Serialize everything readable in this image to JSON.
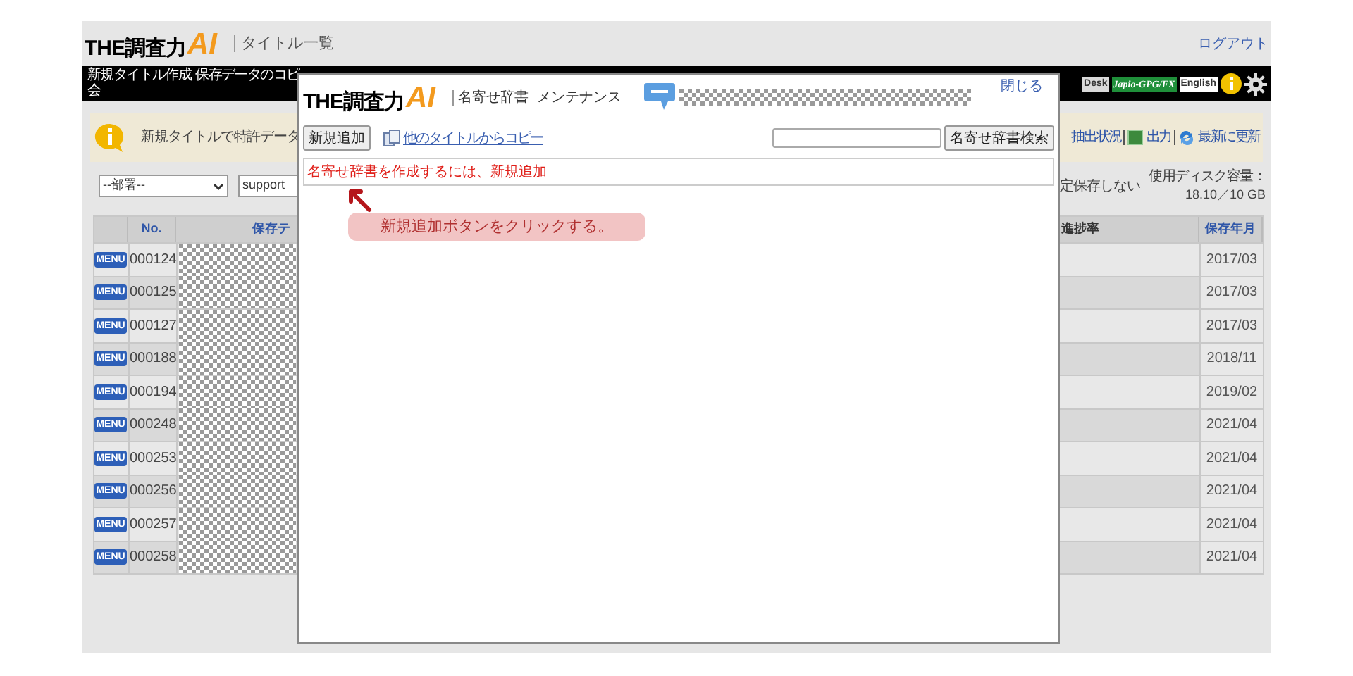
{
  "app_header": {
    "logo": {
      "main": "THE調査力",
      "accent": "AI"
    },
    "page_title": "タイトル一覧",
    "logout_link": "ログアウト"
  },
  "nav_bar": {
    "lines": [
      "新規タイトル作成",
      "保存データのコピ",
      "会"
    ],
    "badges": [
      {
        "label": "Desk",
        "color": "#d9d9d9"
      },
      {
        "label": "Japio-GPG/FX",
        "color": "#1f8f3a"
      },
      {
        "label": "English",
        "color": "#ffffff"
      }
    ]
  },
  "info_banner": {
    "message": "新規タイトルで特許データ",
    "actions": [
      {
        "kind": "text",
        "label": "抽出状況"
      },
      {
        "kind": "export",
        "label": "出力"
      },
      {
        "kind": "refresh",
        "label": "最新に更新"
      }
    ]
  },
  "filters": {
    "department_select": "--部署--",
    "user_field": "support",
    "save_option": "定保存しない",
    "disk_usage_label": "使用ディスク容量：",
    "disk_usage_value": "18.10／10 GB"
  },
  "table": {
    "columns": [
      "No.",
      "保存テ",
      "進捗率",
      "保存年月"
    ],
    "rows": [
      {
        "menu": "MENU",
        "no": "000124",
        "saved": "2017/03"
      },
      {
        "menu": "MENU",
        "no": "000125",
        "saved": "2017/03"
      },
      {
        "menu": "MENU",
        "no": "000127",
        "saved": "2017/03"
      },
      {
        "menu": "MENU",
        "no": "000188",
        "saved": "2018/11"
      },
      {
        "menu": "MENU",
        "no": "000194",
        "saved": "2019/02"
      },
      {
        "menu": "MENU",
        "no": "000248",
        "saved": "2021/04"
      },
      {
        "menu": "MENU",
        "no": "000253",
        "saved": "2021/04"
      },
      {
        "menu": "MENU",
        "no": "000256",
        "saved": "2021/04"
      },
      {
        "menu": "MENU",
        "no": "000257",
        "saved": "2021/04"
      },
      {
        "menu": "MENU",
        "no": "000258",
        "saved": "2021/04"
      }
    ]
  },
  "dialog": {
    "logo": {
      "main": "THE調査力",
      "accent": "AI"
    },
    "title": "名寄せ辞書",
    "subtitle": "メンテナンス",
    "close_link": "閉じる",
    "add_button": "新規追加",
    "copy_link": "他のタイトルからコピー",
    "search_button": "名寄せ辞書検索",
    "message": "名寄せ辞書を作成するには、新規追加"
  },
  "annotation": {
    "callout": "新規追加ボタンをクリックする。"
  }
}
